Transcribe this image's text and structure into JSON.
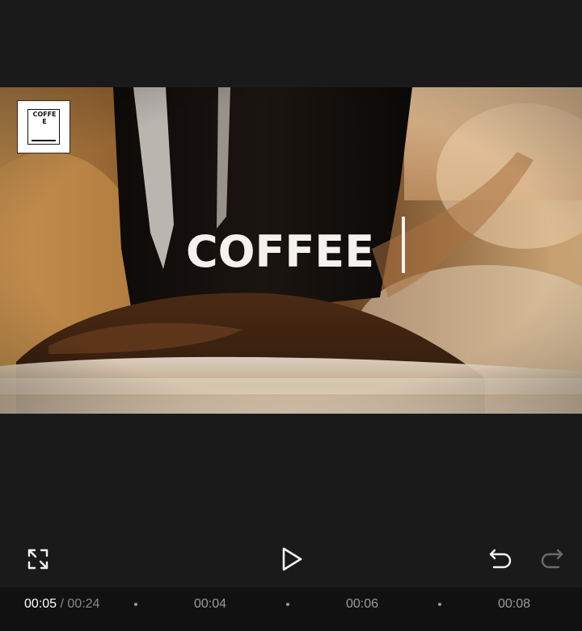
{
  "preview": {
    "title_text": "COFFEE",
    "logo_text": "COFFEE",
    "background_theme": "coffee-grinder-closeup"
  },
  "controls": {
    "fullscreen_icon": "fullscreen-expand-icon",
    "play_icon": "play-icon",
    "undo_icon": "undo-icon",
    "redo_icon": "redo-icon",
    "redo_enabled": false
  },
  "timeline": {
    "current_time": "00:05",
    "separator": "/",
    "total_time": "00:24",
    "ticks": [
      "00:04",
      "00:06",
      "00:08"
    ]
  },
  "colors": {
    "background": "#1a1a1a",
    "timeline_background": "#111111",
    "title_text": "#f4f1ee",
    "icon_active": "#f2f2f2",
    "icon_disabled": "#6a6a6a"
  }
}
